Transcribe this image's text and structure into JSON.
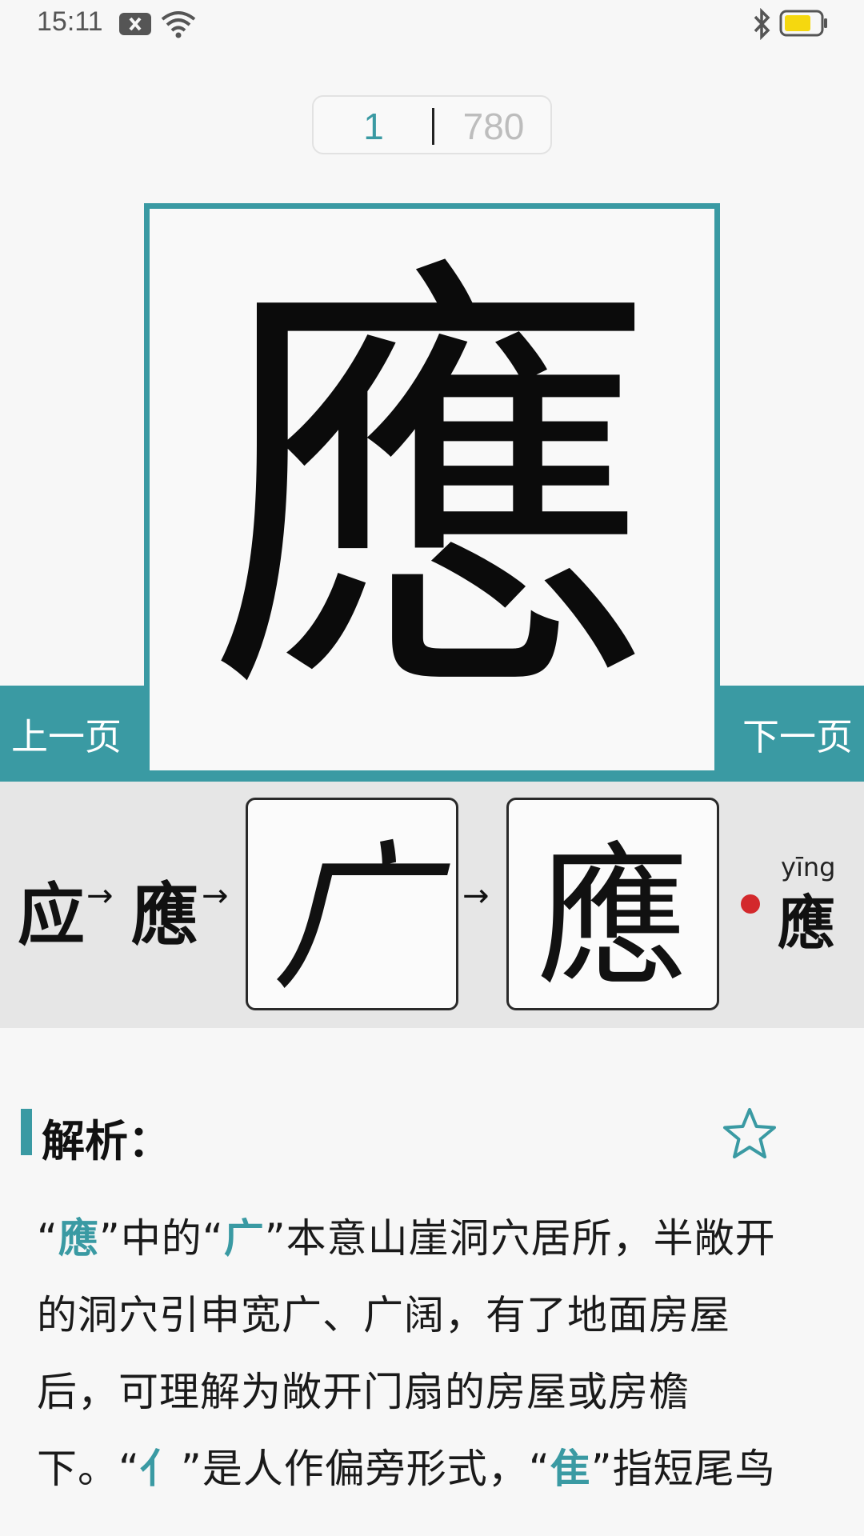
{
  "status_bar": {
    "time": "15:11",
    "icons": [
      "notification-blocked-icon",
      "wifi-icon",
      "bluetooth-icon",
      "battery-icon"
    ],
    "battery_color": "#f5d80f"
  },
  "pager": {
    "current": "1",
    "total": "780"
  },
  "nav": {
    "prev_label": "上一页",
    "next_label": "下一页"
  },
  "main_char": "應",
  "evolution": {
    "simplified": "应",
    "arrow": "→",
    "traditional": "應",
    "ancient_glyph_1": "广",
    "ancient_glyph_2": "應",
    "pinyin": "yīng",
    "pinyin_char": "應"
  },
  "analysis": {
    "title": "解析：",
    "q_open": "“",
    "q_close": "”",
    "t1": "應",
    "p1": "中的",
    "t2": "广",
    "p2": "本意山崖洞穴居所，半敞开的洞穴引申宽广、广阔，有了地面房屋后，可理解为敞开门扇的房屋或房檐下。",
    "t3": "亻",
    "p3": "是人作偏旁形式，",
    "t4": "隹",
    "p4": "指短尾鸟"
  },
  "colors": {
    "accent": "#3a9aa3",
    "dot": "#d3292c",
    "strip_bg": "#e6e6e6"
  }
}
